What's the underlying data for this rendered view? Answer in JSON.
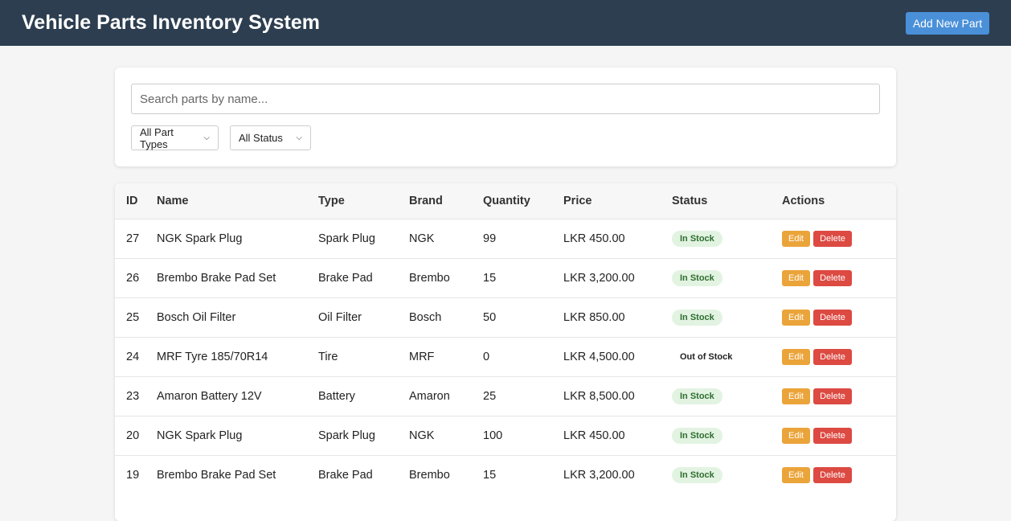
{
  "header": {
    "title": "Vehicle Parts Inventory System",
    "add_label": "Add New Part"
  },
  "filters": {
    "search_placeholder": "Search parts by name...",
    "type_selected": "All Part Types",
    "status_selected": "All Status"
  },
  "table": {
    "columns": [
      "ID",
      "Name",
      "Type",
      "Brand",
      "Quantity",
      "Price",
      "Status",
      "Actions"
    ],
    "edit_label": "Edit",
    "delete_label": "Delete",
    "rows": [
      {
        "id": "27",
        "name": "NGK Spark Plug",
        "type": "Spark Plug",
        "brand": "NGK",
        "qty": "99",
        "price": "LKR 450.00",
        "status": "In Stock",
        "in": true
      },
      {
        "id": "26",
        "name": "Brembo Brake Pad Set",
        "type": "Brake Pad",
        "brand": "Brembo",
        "qty": "15",
        "price": "LKR 3,200.00",
        "status": "In Stock",
        "in": true
      },
      {
        "id": "25",
        "name": "Bosch Oil Filter",
        "type": "Oil Filter",
        "brand": "Bosch",
        "qty": "50",
        "price": "LKR 850.00",
        "status": "In Stock",
        "in": true
      },
      {
        "id": "24",
        "name": "MRF Tyre 185/70R14",
        "type": "Tire",
        "brand": "MRF",
        "qty": "0",
        "price": "LKR 4,500.00",
        "status": "Out of Stock",
        "in": false
      },
      {
        "id": "23",
        "name": "Amaron Battery 12V",
        "type": "Battery",
        "brand": "Amaron",
        "qty": "25",
        "price": "LKR 8,500.00",
        "status": "In Stock",
        "in": true
      },
      {
        "id": "20",
        "name": "NGK Spark Plug",
        "type": "Spark Plug",
        "brand": "NGK",
        "qty": "100",
        "price": "LKR 450.00",
        "status": "In Stock",
        "in": true
      },
      {
        "id": "19",
        "name": "Brembo Brake Pad Set",
        "type": "Brake Pad",
        "brand": "Brembo",
        "qty": "15",
        "price": "LKR 3,200.00",
        "status": "In Stock",
        "in": true
      }
    ]
  }
}
